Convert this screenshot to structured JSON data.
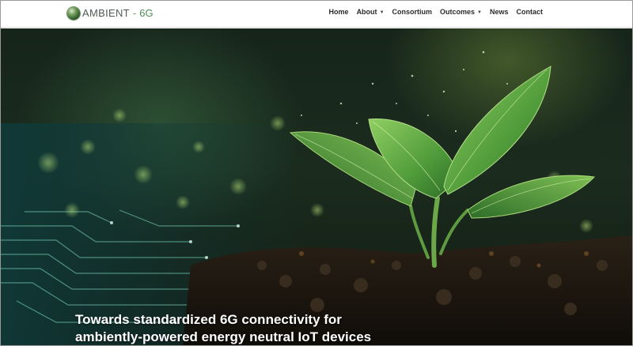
{
  "brand": {
    "name": "AMBIENT",
    "separator": "-",
    "suffix": "6G"
  },
  "nav": {
    "items": [
      {
        "label": "Home",
        "has_dropdown": false
      },
      {
        "label": "About",
        "has_dropdown": true
      },
      {
        "label": "Consortium",
        "has_dropdown": false
      },
      {
        "label": "Outcomes",
        "has_dropdown": true
      },
      {
        "label": "News",
        "has_dropdown": false
      },
      {
        "label": "Contact",
        "has_dropdown": false
      }
    ],
    "dropdown_icon": "chevron-down-icon"
  },
  "hero": {
    "title_line1": "Towards standardized 6G connectivity for",
    "title_line2": "ambiently-powered energy neutral IoT devices",
    "image_description_icon": "sprouting-plant-circuit-board-image"
  },
  "colors": {
    "accent_green": "#4e8d56",
    "header_bg": "#ffffff",
    "nav_text": "#2b2b2b",
    "hero_text": "#ffffff"
  }
}
